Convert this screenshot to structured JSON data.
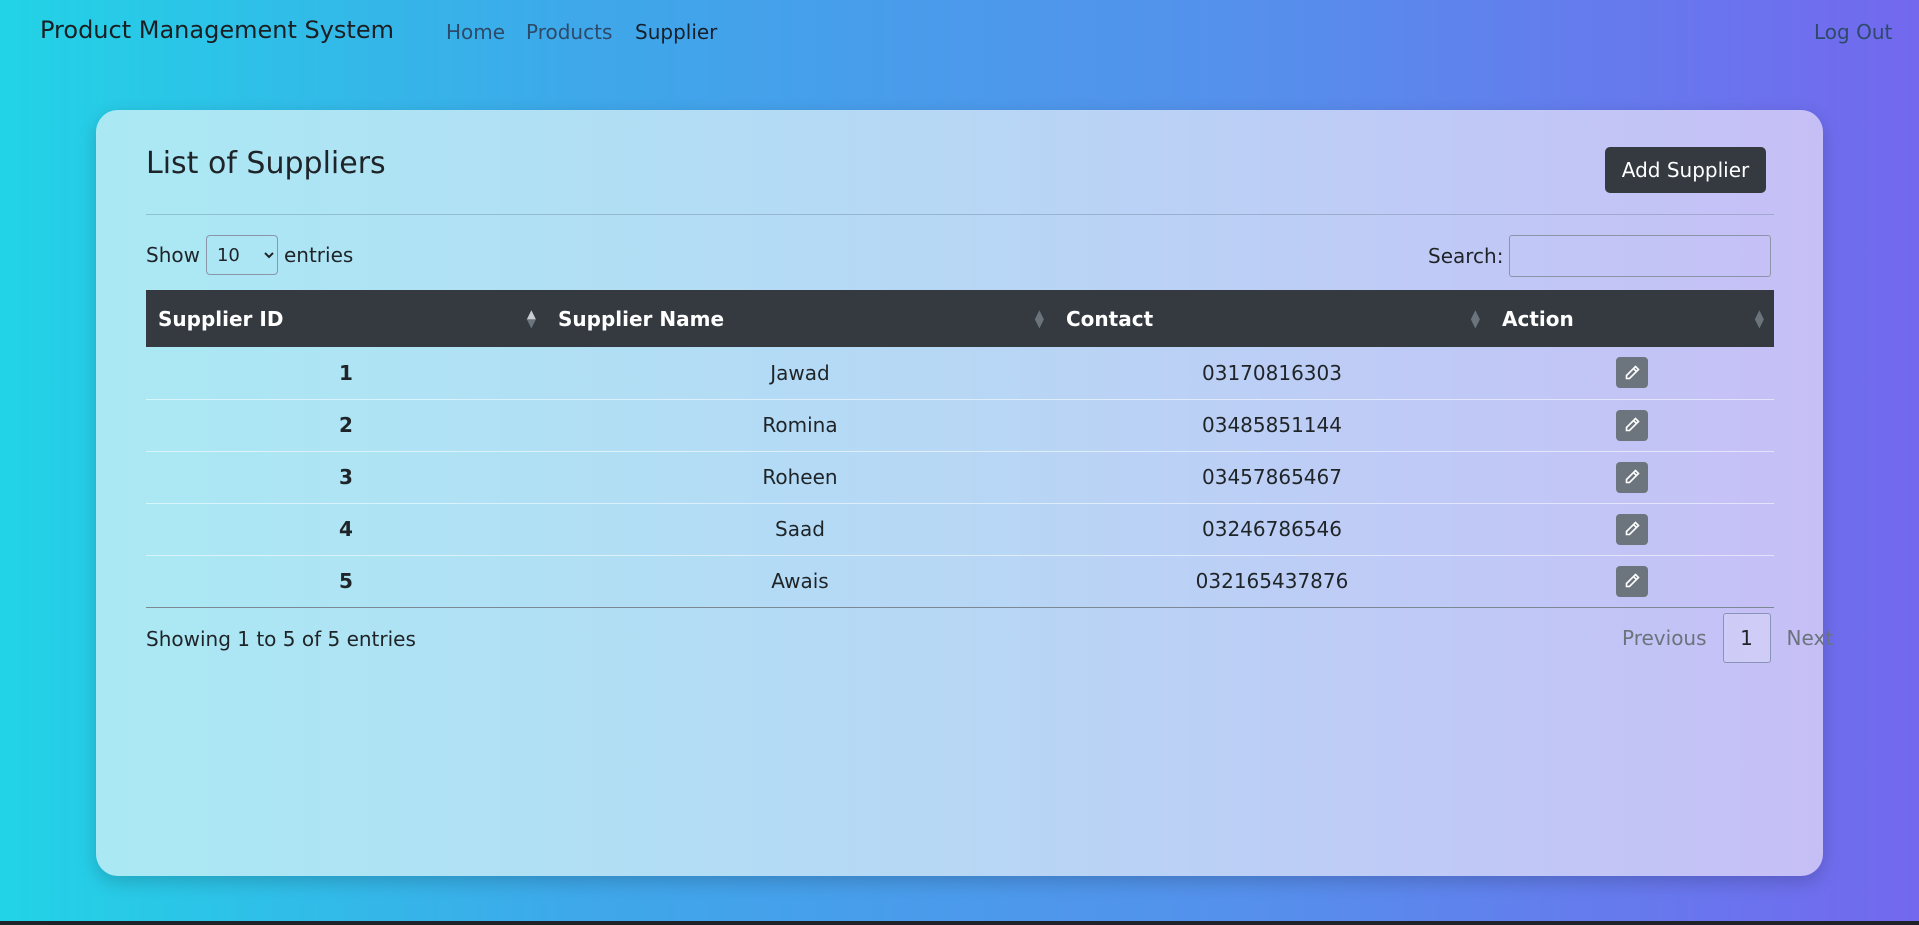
{
  "navbar": {
    "brand": "Product Management System",
    "links": [
      "Home",
      "Products",
      "Supplier"
    ],
    "logout": "Log Out"
  },
  "card": {
    "title": "List of Suppliers",
    "add_button": "Add Supplier"
  },
  "length_menu": {
    "show_label": "Show",
    "selected": "10",
    "options": [
      "10"
    ],
    "entries_label": "entries"
  },
  "search": {
    "label": "Search:",
    "value": ""
  },
  "table": {
    "headers": [
      "Supplier ID",
      "Supplier Name",
      "Contact",
      "Action"
    ],
    "rows": [
      {
        "id": "1",
        "name": "Jawad",
        "contact": "03170816303"
      },
      {
        "id": "2",
        "name": "Romina",
        "contact": "03485851144"
      },
      {
        "id": "3",
        "name": "Roheen",
        "contact": "03457865467"
      },
      {
        "id": "4",
        "name": "Saad",
        "contact": "03246786546"
      },
      {
        "id": "5",
        "name": "Awais",
        "contact": "032165437876"
      }
    ],
    "action_icon": "pencil-icon"
  },
  "info": "Showing 1 to 5 of 5 entries",
  "pagination": {
    "previous": "Previous",
    "current": "1",
    "next": "Next"
  },
  "colors": {
    "header_bg": "#343a40",
    "edit_button_bg": "#6c757d"
  }
}
